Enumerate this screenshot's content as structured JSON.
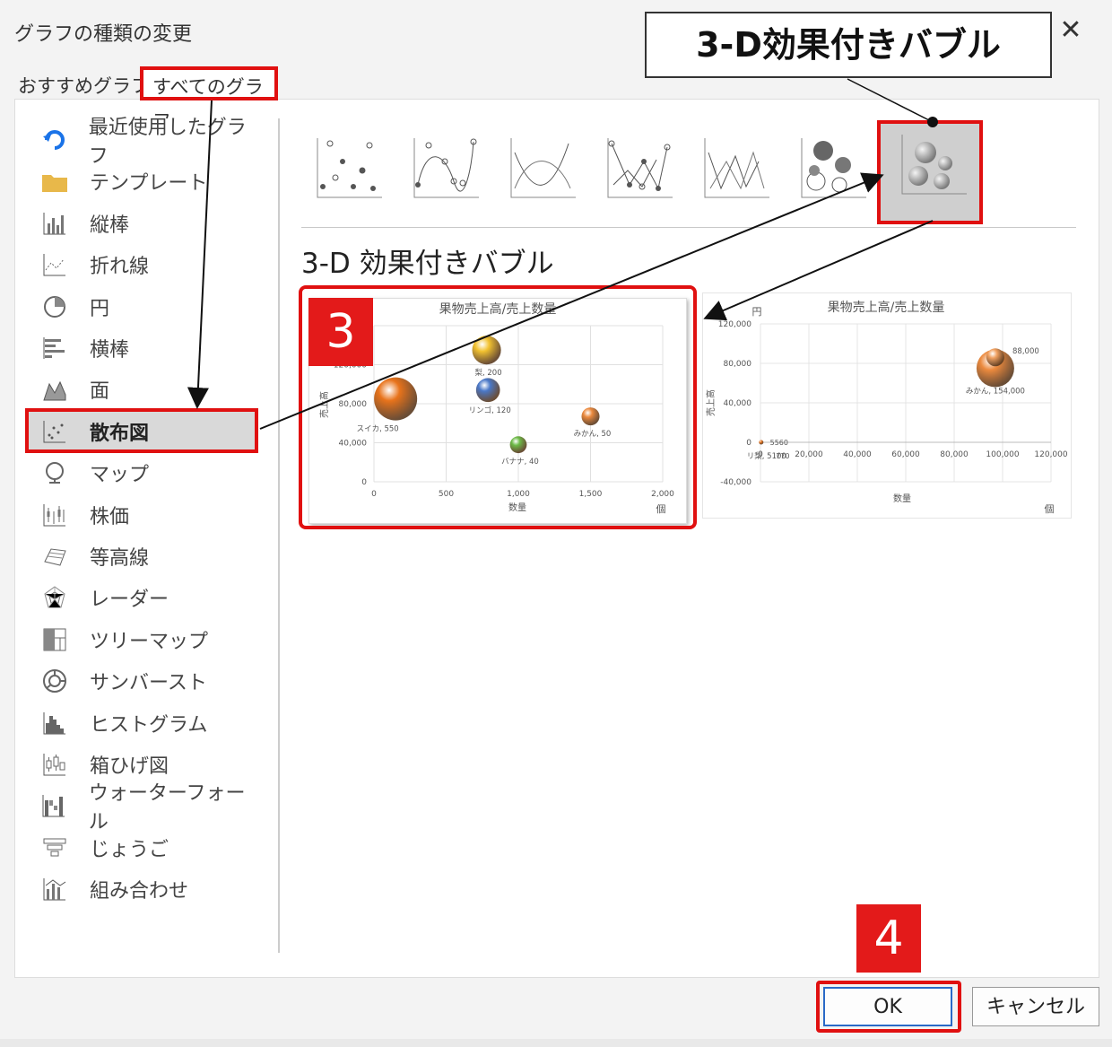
{
  "window": {
    "title": "グラフの種類の変更",
    "close_glyph": "✕"
  },
  "tabs": [
    {
      "label": "おすすめグラフ",
      "active": false
    },
    {
      "label": "すべてのグラフ",
      "active": true
    }
  ],
  "sidebar": {
    "items": [
      {
        "label": "最近使用したグラフ",
        "icon": "recent-icon"
      },
      {
        "label": "テンプレート",
        "icon": "folder-icon"
      },
      {
        "label": "縦棒",
        "icon": "column-chart-icon"
      },
      {
        "label": "折れ線",
        "icon": "line-chart-icon"
      },
      {
        "label": "円",
        "icon": "pie-chart-icon"
      },
      {
        "label": "横棒",
        "icon": "bar-chart-icon"
      },
      {
        "label": "面",
        "icon": "area-chart-icon"
      },
      {
        "label": "散布図",
        "icon": "scatter-chart-icon",
        "selected": true
      },
      {
        "label": "マップ",
        "icon": "map-icon"
      },
      {
        "label": "株価",
        "icon": "stock-chart-icon"
      },
      {
        "label": "等高線",
        "icon": "surface-chart-icon"
      },
      {
        "label": "レーダー",
        "icon": "radar-chart-icon"
      },
      {
        "label": "ツリーマップ",
        "icon": "treemap-icon"
      },
      {
        "label": "サンバースト",
        "icon": "sunburst-icon"
      },
      {
        "label": "ヒストグラム",
        "icon": "histogram-icon"
      },
      {
        "label": "箱ひげ図",
        "icon": "box-whisker-icon"
      },
      {
        "label": "ウォーターフォール",
        "icon": "waterfall-icon"
      },
      {
        "label": "じょうご",
        "icon": "funnel-icon"
      },
      {
        "label": "組み合わせ",
        "icon": "combo-chart-icon"
      }
    ]
  },
  "subtypes": {
    "selected_title": "3-D 効果付きバブル",
    "items": [
      "scatter-markers-icon",
      "scatter-smooth-markers-icon",
      "scatter-smooth-icon",
      "scatter-straight-markers-icon",
      "scatter-straight-icon",
      "bubble-icon",
      "bubble-3d-icon"
    ]
  },
  "callout": {
    "text": "3-D効果付きバブル"
  },
  "steps": {
    "step3": "3",
    "step4": "4"
  },
  "buttons": {
    "ok": "OK",
    "cancel": "キャンセル"
  },
  "chart_data": [
    {
      "type": "scatter",
      "title": "果物売上高/売上数量",
      "xlabel": "数量",
      "ylabel": "売上高",
      "x_unit": "個",
      "xlim": [
        0,
        2000
      ],
      "ylim": [
        0,
        160000
      ],
      "x_ticks": [
        "0",
        "500",
        "1,000",
        "1,500",
        "2,000"
      ],
      "y_ticks": [
        "0",
        "40,000",
        "80,000",
        "120,000"
      ],
      "points": [
        {
          "label": "スイカ, 550",
          "x": 150,
          "y": 85000,
          "size": 550,
          "color": "#e8731b"
        },
        {
          "label": "梨, 200",
          "x": 780,
          "y": 135000,
          "size": 200,
          "color": "#f2c230"
        },
        {
          "label": "リンゴ, 120",
          "x": 790,
          "y": 94000,
          "size": 120,
          "color": "#4a78c8"
        },
        {
          "label": "バナナ, 40",
          "x": 1000,
          "y": 38000,
          "size": 40,
          "color": "#6cba47"
        },
        {
          "label": "みかん, 50",
          "x": 1500,
          "y": 67000,
          "size": 50,
          "color": "#ec8a3e"
        }
      ]
    },
    {
      "type": "scatter",
      "title": "果物売上高/売上数量",
      "xlabel": "数量",
      "ylabel": "売上高",
      "y_unit": "円",
      "x_unit": "個",
      "xlim": [
        0,
        120000
      ],
      "ylim": [
        -40000,
        120000
      ],
      "x_ticks": [
        "0",
        "20,000",
        "40,000",
        "60,000",
        "80,000",
        "100,000",
        "120,000"
      ],
      "y_ticks": [
        "120,000",
        "80,000",
        "40,000",
        "0",
        "-40,000"
      ],
      "points": [
        {
          "label": "みかん, 154,000",
          "x": 97000,
          "y": 75000,
          "size": 154000,
          "color": "#ec8a3e"
        },
        {
          "label": "88,000",
          "x": 97000,
          "y": 88000,
          "size": 88000,
          "color": "#f0a060"
        },
        {
          "label": "リ梨, 5100",
          "x": 300,
          "y": 0,
          "size": 500,
          "color": "#e8731b"
        }
      ],
      "extra_labels": [
        "5560",
        "770"
      ]
    }
  ]
}
